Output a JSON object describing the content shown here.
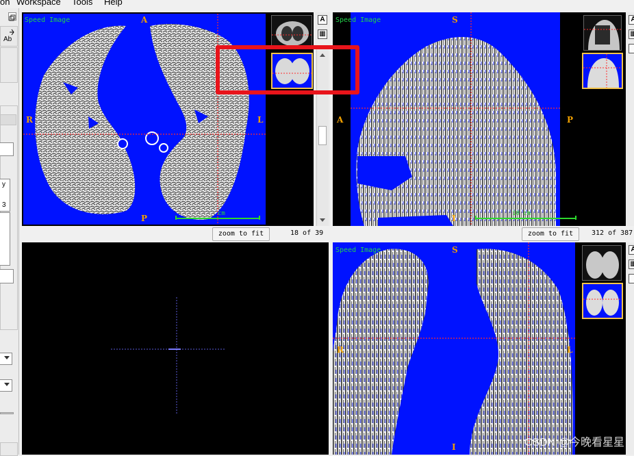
{
  "menubar": {
    "items": [
      {
        "label": "on"
      },
      {
        "label": "Workspace"
      },
      {
        "label": "Tools"
      },
      {
        "label": "Help"
      }
    ]
  },
  "left_panel": {
    "tool_label": "Ab",
    "field_value_1": "y",
    "field_value_2": "3"
  },
  "views": {
    "axial": {
      "title": "Speed Image",
      "orient_top": "A",
      "orient_bottom": "P",
      "orient_left": "R",
      "orient_right": "L",
      "scale_label": "cm",
      "zoom_label": "zoom to fit",
      "slice_label": "18 of 39",
      "tool_buttons": [
        "A",
        "▦"
      ]
    },
    "sagittal": {
      "title": "Speed Image",
      "orient_top": "S",
      "orient_bottom": "I",
      "orient_left": "A",
      "orient_right": "P",
      "scale_label": "10 cm",
      "zoom_label": "zoom to fit",
      "slice_label": "312 of 387",
      "tool_buttons": [
        "A",
        "▦"
      ]
    },
    "coronal": {
      "title": "Speed Image",
      "orient_top": "S",
      "orient_bottom": "I",
      "orient_left": "R",
      "orient_right": "L",
      "tool_buttons": [
        "A",
        "▦"
      ]
    }
  },
  "watermark": "CSDN @今晚看星星",
  "colors": {
    "segmentation_blue": "#0012ff",
    "orientation_label": "#f0a000",
    "image_title_green": "#23d14b",
    "crosshair_red": "#ff2a2a",
    "highlight_red": "#e8141b",
    "active_thumb_border": "#f2c34a"
  },
  "icons": {
    "restore_window": "restore-window-icon",
    "annotation_tool": "annotation-tool-icon",
    "layout_toggle": "layout-grid-icon",
    "camera": "camera-icon"
  }
}
